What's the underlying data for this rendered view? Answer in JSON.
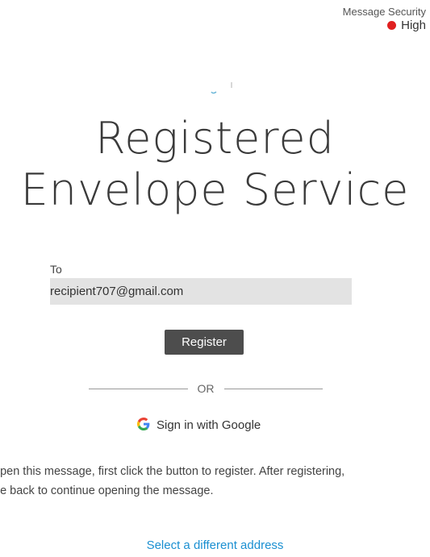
{
  "security": {
    "label": "Message Security",
    "level": "High",
    "level_color": "#e02020"
  },
  "title": {
    "line1": "Registered",
    "line2": "Envelope Service"
  },
  "recipient": {
    "to_label": "To",
    "email": "recipient707@gmail.com"
  },
  "actions": {
    "register_label": "Register",
    "or_label": "OR",
    "google_signin_label": "Sign in with Google",
    "select_address_label": "Select a different address"
  },
  "instructions": {
    "line1": "open this message, first click the button to register. After registering,",
    "line2": "ne back to continue opening the message."
  },
  "colors": {
    "button_bg": "#4d4d4d",
    "link": "#1a8fd1",
    "field_bg": "#e3e3e3"
  }
}
